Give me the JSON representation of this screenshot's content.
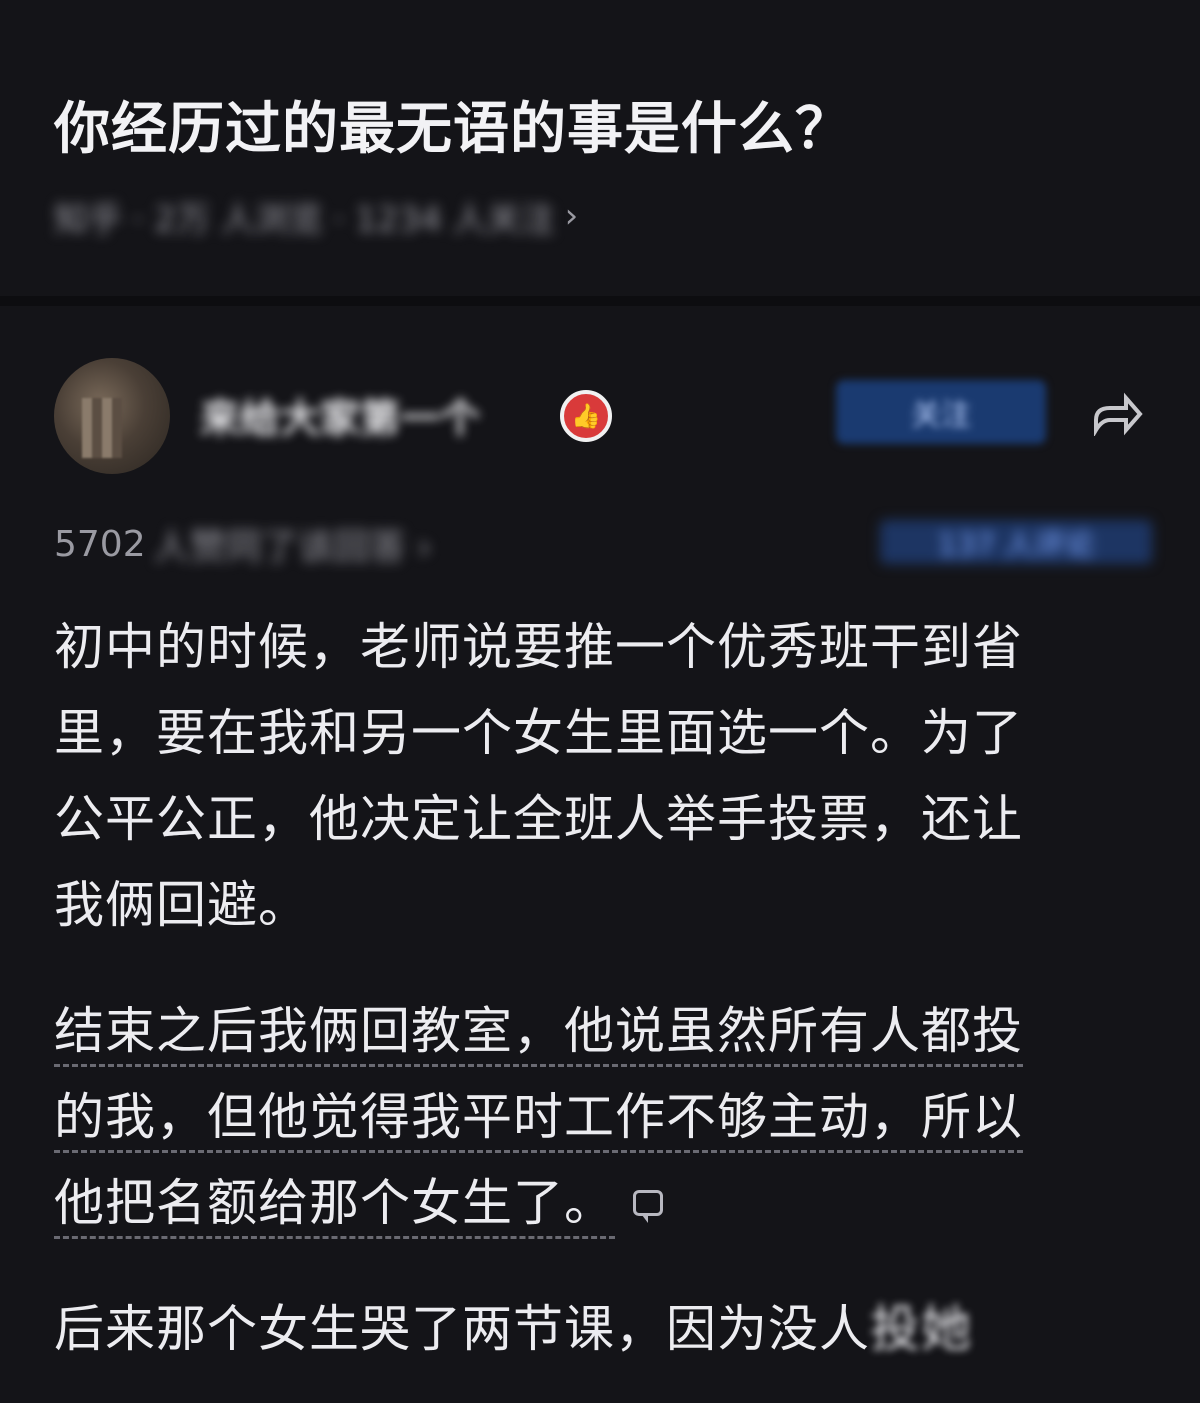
{
  "question": {
    "title": "你经历过的最无语的事是什么？",
    "meta": "知乎 · 2万 人浏览 · 1234 人关注",
    "chevron": "›"
  },
  "author": {
    "name": "来给大家第一个",
    "badge_icon": "thumbs-up-icon",
    "follow_label": "关注",
    "share_icon": "share-icon"
  },
  "stats": {
    "count": "5702",
    "suffix": "人赞同了该回答 ›",
    "right": "137 人评论"
  },
  "answer": {
    "para1": [
      "初中的时候，老师说要推一个优秀班干到省",
      "里，要在我和另一个女生里面选一个。为了",
      "公平公正，他决定让全班人举手投票，还让",
      "我俩回避。"
    ],
    "para2": [
      "结束之后我俩回教室，他说虽然所有人都投",
      "的我，但他觉得我平时工作不够主动，所以",
      "他把名额给那个女生了。"
    ],
    "para3_visible": "后来那个女生哭了两节课，因为没人",
    "para3_blurred": "投她"
  }
}
